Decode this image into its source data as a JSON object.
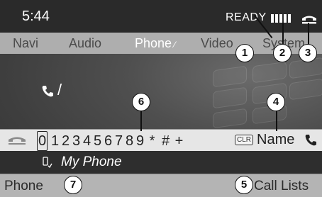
{
  "status": {
    "time": "5:44",
    "ready_text": "READY",
    "signal_bars": 5
  },
  "menu": [
    {
      "label": "Navi",
      "active": false
    },
    {
      "label": "Audio",
      "active": false
    },
    {
      "label": "Phone",
      "active": true
    },
    {
      "label": "Video",
      "active": false
    },
    {
      "label": "System",
      "active": false
    }
  ],
  "dial": {
    "cursor": "/"
  },
  "char_bar": {
    "chars": [
      "0",
      "1",
      "2",
      "3",
      "4",
      "5",
      "6",
      "7",
      "8",
      "9",
      "*",
      "#",
      "+"
    ],
    "selected": "0",
    "clr_label": "CLR",
    "name_label": "Name"
  },
  "device": {
    "name": "My Phone"
  },
  "bottom": {
    "left": "Phone",
    "right": "Call Lists"
  },
  "callouts": [
    "1",
    "2",
    "3",
    "4",
    "5",
    "6",
    "7"
  ],
  "colors": {
    "status_bg": "#2a2a2a",
    "menu_bg": "#aeaeae",
    "char_bar_bg": "#e6e6e6",
    "device_bg": "#2e2e2e",
    "bottom_bg": "#b4b4b4"
  }
}
